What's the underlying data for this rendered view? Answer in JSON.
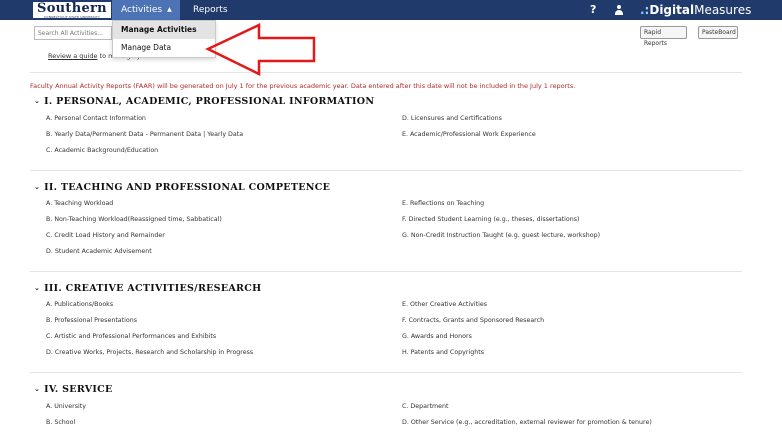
{
  "header": {
    "logo_main": "Southern",
    "logo_sub": "CONNECTICUT STATE UNIVERSITY",
    "nav_activities": "Activities",
    "nav_reports": "Reports",
    "help_label": "?",
    "brand_dots": ".:",
    "brand_bold": "Digital",
    "brand_rest": "Measures",
    "colors": {
      "bar": "#1f3a6b",
      "active_tab": "#4c73b5"
    }
  },
  "toolbar": {
    "search_placeholder": "Search All Activities...",
    "rapid_reports": "Rapid Reports",
    "pasteboard": "PasteBoard",
    "guide_link": "Review a guide",
    "guide_rest": "to manage your activities."
  },
  "dropdown": {
    "items": [
      {
        "label": "Manage Activities"
      },
      {
        "label": "Manage Data"
      }
    ]
  },
  "notice": "Faculty Annual Activity Reports (FAAR) will be generated on July 1 for the previous academic year. Data entered after this date will not be included in the July 1 reports.",
  "sections": [
    {
      "title": "I. PERSONAL, ACADEMIC, PROFESSIONAL INFORMATION",
      "left": [
        "A. Personal Contact Information",
        "B. Yearly Data/Permanent Data - Permanent Data | Yearly Data",
        "C. Academic Background/Education"
      ],
      "right": [
        "D. Licensures and Certifications",
        "E. Academic/Professional Work Experience"
      ]
    },
    {
      "title": "II. TEACHING AND PROFESSIONAL COMPETENCE",
      "left": [
        "A. Teaching Workload",
        "B. Non-Teaching Workload(Reassigned time, Sabbatical)",
        "C. Credit Load History and Remainder",
        "D. Student Academic Advisement"
      ],
      "right": [
        "E. Reflections on Teaching",
        "F. Directed Student Learning (e.g., theses, dissertations)",
        "G. Non-Credit Instruction Taught (e.g. guest lecture, workshop)"
      ]
    },
    {
      "title": "III. CREATIVE ACTIVITIES/RESEARCH",
      "left": [
        "A. Publications/Books",
        "B. Professional Presentations",
        "C. Artistic and Professional Performances and Exhibits",
        "D. Creative Works, Projects, Research and Scholarship in Progress"
      ],
      "right": [
        "E. Other Creative Activities",
        "F. Contracts, Grants and Sponsored Research",
        "G. Awards and Honors",
        "H. Patents and Copyrights"
      ]
    },
    {
      "title": "IV. SERVICE",
      "left": [
        "A. University",
        "B. School"
      ],
      "right": [
        "C. Department",
        "D. Other Service (e.g., accreditation, external reviewer for promotion & tenure)"
      ]
    }
  ]
}
